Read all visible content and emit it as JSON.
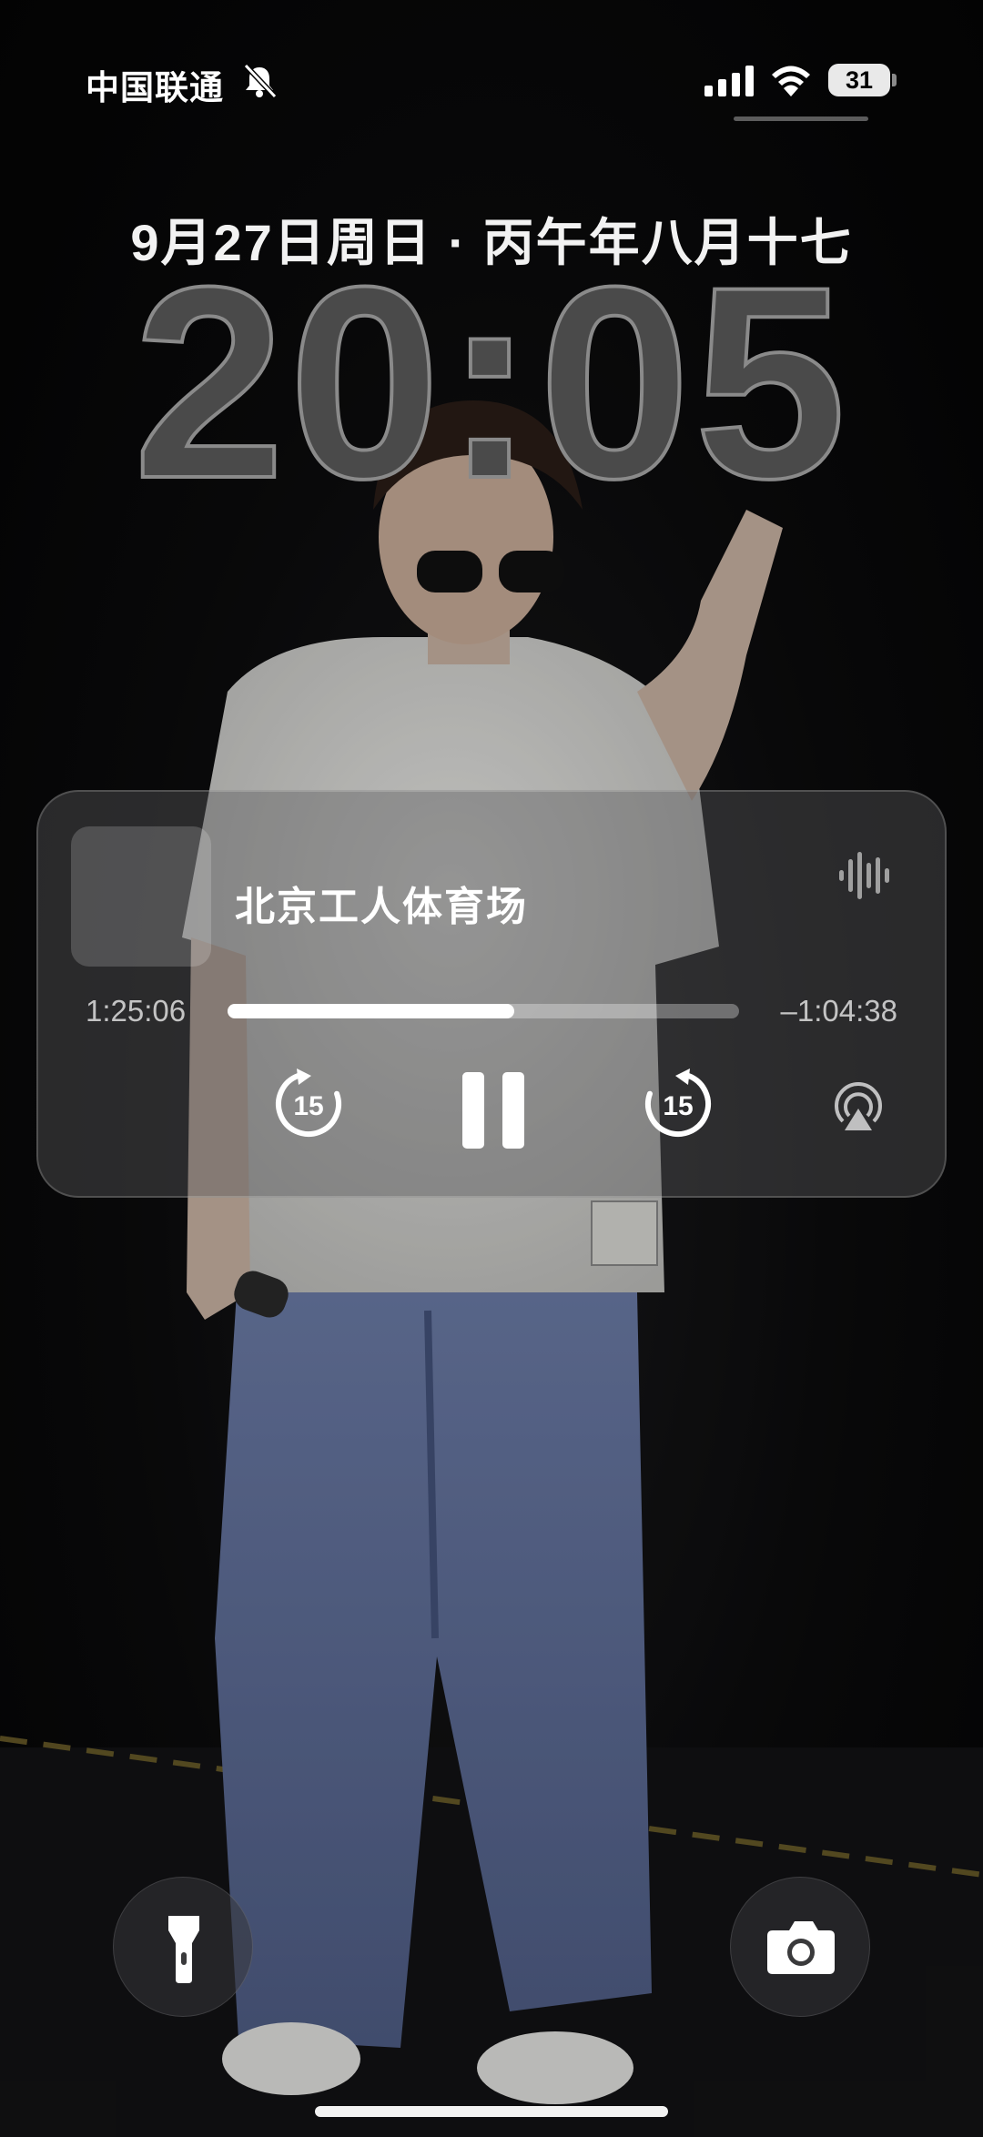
{
  "status_bar": {
    "carrier": "中国联通",
    "battery_level": "31",
    "icons": [
      "bell-slash-icon",
      "cellular-signal-icon",
      "wifi-icon",
      "battery-icon"
    ]
  },
  "lock_screen": {
    "date": "9月27日周日 · 丙午年八月十七",
    "time": "20:05"
  },
  "now_playing": {
    "title": "北京工人体育场",
    "elapsed": "1:25:06",
    "remaining": "–1:04:38",
    "progress": 0.56,
    "skip_back_seconds": "15",
    "skip_forward_seconds": "15",
    "icons": [
      "waveform-icon",
      "skip-back-15-icon",
      "pause-icon",
      "skip-forward-15-icon",
      "airplay-icon"
    ]
  },
  "quick_actions": {
    "icons": [
      "flashlight-icon",
      "camera-icon"
    ]
  },
  "colors": {
    "card": "#5a5a5c",
    "clock": "#4a4a4a",
    "progress_fill": "#ffffff"
  }
}
